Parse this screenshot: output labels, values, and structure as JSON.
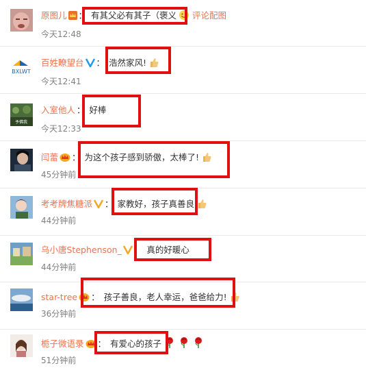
{
  "accent_color": "#eb7350",
  "highlight_color": "#e01010",
  "comments": [
    {
      "user": "原图儿",
      "badge": "crown-badge",
      "text": "有其父必有其子（褒义",
      "emoji": "smiley-emoji",
      "extra_link": "评论配图",
      "time": "今天12:48"
    },
    {
      "user": "百姓瞭望台",
      "badge": "v-verified-badge",
      "text": "浩然家风!",
      "emoji": "thumbs-up-emoji",
      "time": "今天12:41"
    },
    {
      "user": "入室他人",
      "badge": "",
      "text": "好棒",
      "time": "今天12:33"
    },
    {
      "user": "闫蕾",
      "badge": "vip-crown-badge",
      "text": "为这个孩子感到骄傲，太棒了!",
      "emoji": "thumbs-up-emoji",
      "time": "45分钟前"
    },
    {
      "user": "考考牌焦糖派",
      "badge": "v-yellow-badge",
      "text": "家教好，孩子真善良",
      "emoji": "thumbs-up-emoji",
      "time": "44分钟前"
    },
    {
      "user": "乌小唐Stephenson_",
      "badge": "v-yellow-badge",
      "text": "真的好暖心",
      "time": "44分钟前"
    },
    {
      "user": "star-tree",
      "badge": "vip-crown-badge",
      "text": "孩子善良，老人幸运，爸爸给力!",
      "emoji": "thumbs-up-emoji",
      "time": "36分钟前"
    },
    {
      "user": "栀子微语录",
      "badge": "vip-crown-badge",
      "text": "有爱心的孩子",
      "emoji": "rose-emoji x3",
      "time": "51分钟前"
    }
  ]
}
